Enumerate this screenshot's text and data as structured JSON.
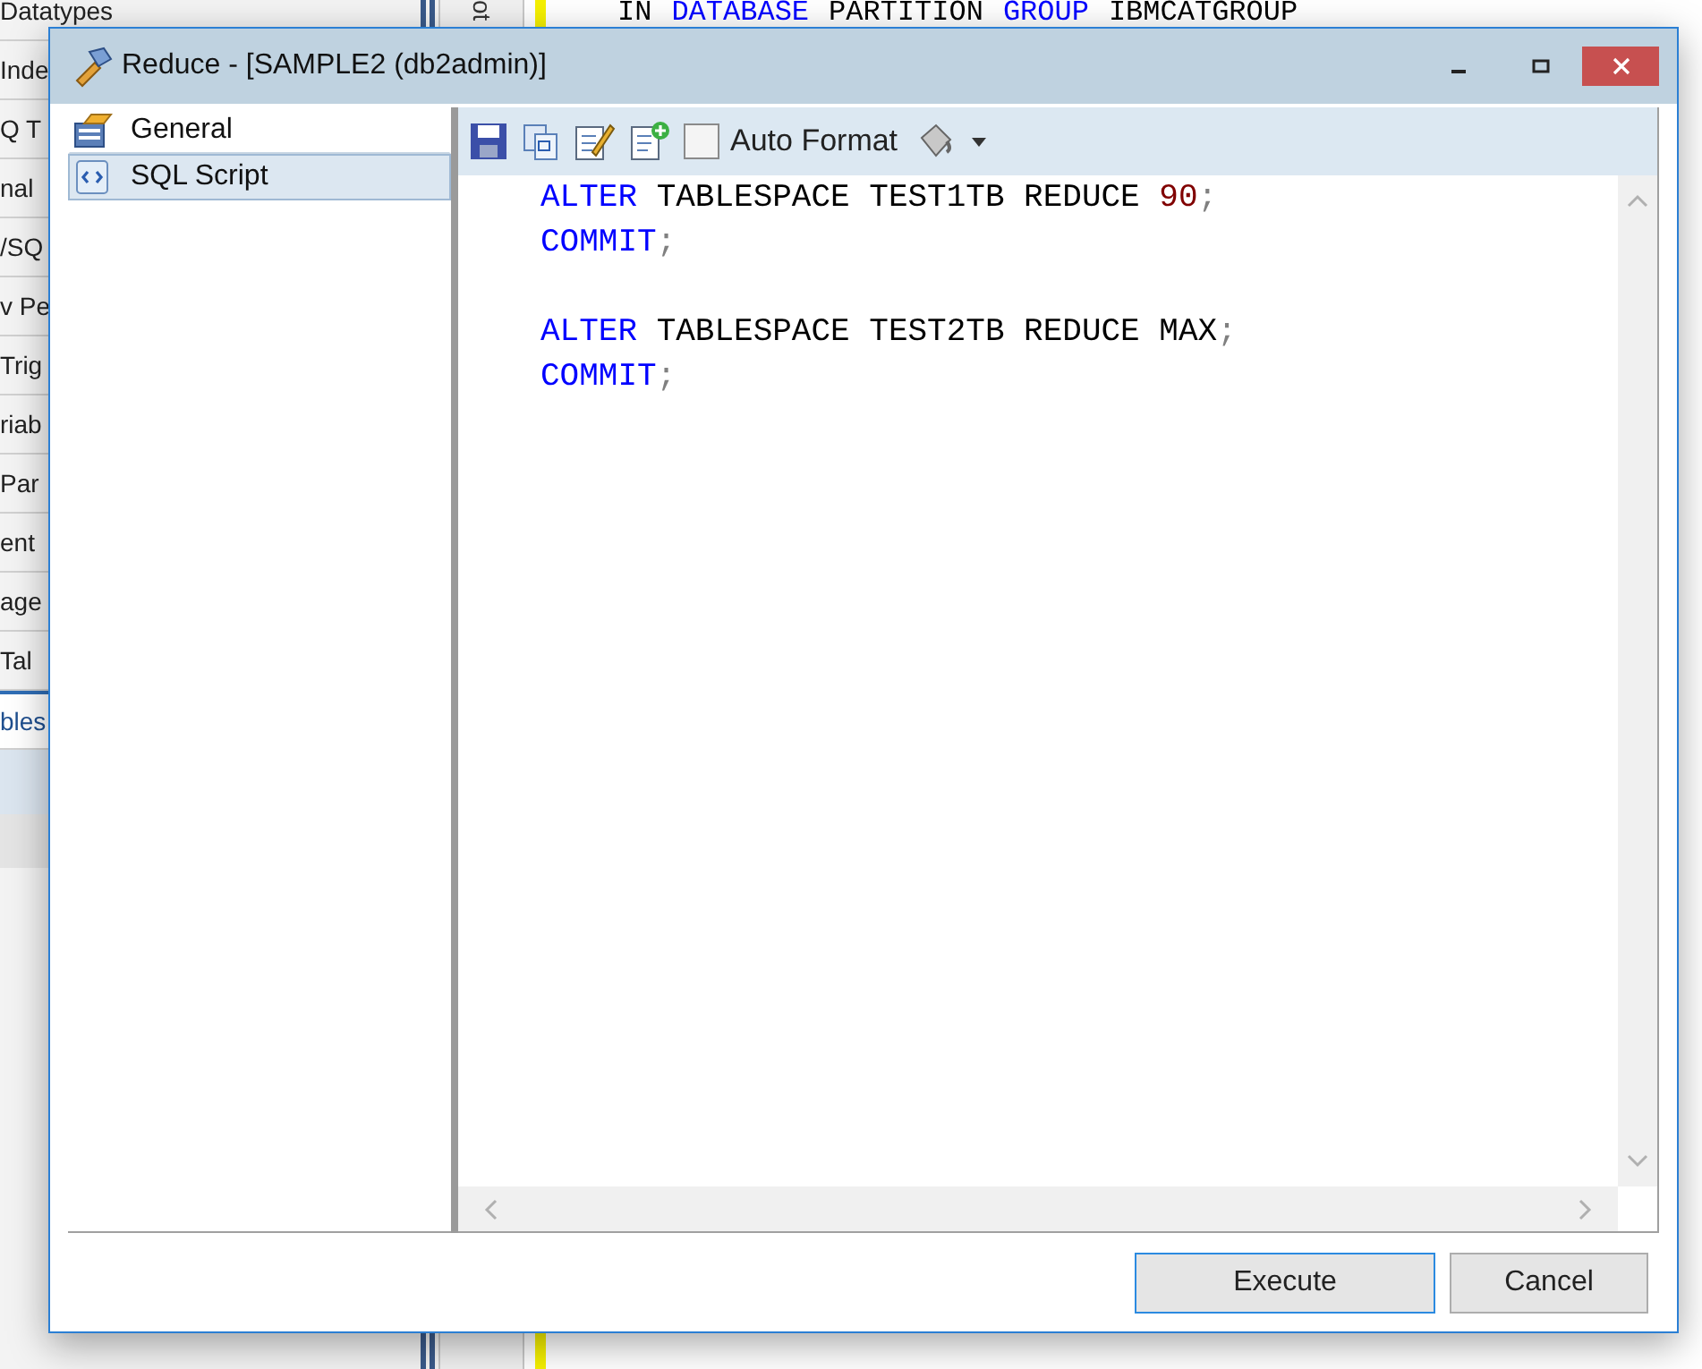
{
  "background": {
    "tree_items": [
      {
        "label": "Datatypes",
        "selected": false
      },
      {
        "label": "Inde",
        "selected": false
      },
      {
        "label": "Q T",
        "selected": false
      },
      {
        "label": "nal",
        "selected": false
      },
      {
        "label": "/SQ",
        "selected": false
      },
      {
        "label": "v Pe",
        "selected": false
      },
      {
        "label": "Trig",
        "selected": false
      },
      {
        "label": "riab",
        "selected": false
      },
      {
        "label": "Par",
        "selected": false
      },
      {
        "label": "ent",
        "selected": false
      },
      {
        "label": "age",
        "selected": false
      },
      {
        "label": "Tal",
        "selected": false
      },
      {
        "label": "bles",
        "selected": true
      }
    ],
    "side_tab": "ot",
    "code_line": [
      {
        "text": "IN",
        "kind": "plain"
      },
      {
        "text": "DATABASE",
        "kind": "keyword"
      },
      {
        "text": "PARTITION",
        "kind": "plain"
      },
      {
        "text": "GROUP",
        "kind": "keyword"
      },
      {
        "text": "IBMCATGROUP",
        "kind": "plain"
      }
    ]
  },
  "dialog": {
    "title": "Reduce - [SAMPLE2 (db2admin)]",
    "nav_items": [
      {
        "label": "General",
        "kind": "general",
        "selected": false
      },
      {
        "label": "SQL Script",
        "kind": "script",
        "selected": true
      }
    ],
    "toolbar": {
      "auto_format": {
        "label": "Auto Format",
        "checked": false
      }
    },
    "editor_blocks": [
      {
        "lines": [
          [
            {
              "text": "ALTER",
              "kind": "keyword"
            },
            {
              "text": " TABLESPACE TEST1TB REDUCE ",
              "kind": "plain"
            },
            {
              "text": "90",
              "kind": "number"
            },
            {
              "text": ";",
              "kind": "punct"
            }
          ],
          [
            {
              "text": "COMMIT",
              "kind": "keyword"
            },
            {
              "text": ";",
              "kind": "punct"
            }
          ]
        ]
      },
      {
        "lines": [
          [
            {
              "text": "ALTER",
              "kind": "keyword"
            },
            {
              "text": " TABLESPACE TEST2TB REDUCE MAX",
              "kind": "plain"
            },
            {
              "text": ";",
              "kind": "punct"
            }
          ],
          [
            {
              "text": "COMMIT",
              "kind": "keyword"
            },
            {
              "text": ";",
              "kind": "punct"
            }
          ]
        ]
      }
    ],
    "buttons": [
      {
        "label": "Execute",
        "default": true
      },
      {
        "label": "Cancel",
        "default": false
      }
    ]
  }
}
